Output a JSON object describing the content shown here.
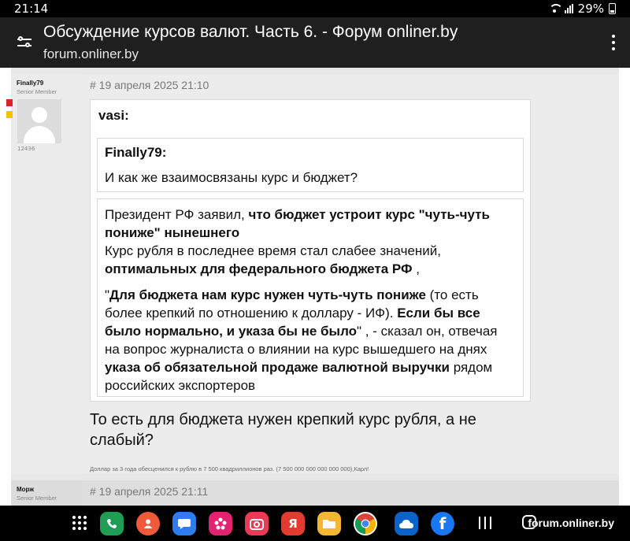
{
  "status": {
    "time": "21:14",
    "battery": "29%"
  },
  "browser": {
    "title": "Обсуждение курсов валют. Часть 6. - Форум onliner.by",
    "url": "forum.onliner.by"
  },
  "posts": [
    {
      "author": "Finally79",
      "rank": "Senior Member",
      "count": "12436",
      "date": "# 19 апреля 2025 21:10",
      "quote_author": "vasi:",
      "inner_quote_author": "Finally79:",
      "inner_quote_text": "И как же взаимосвязаны курс и бюджет?",
      "article": {
        "p1_a": "Президент РФ заявил, ",
        "p1_b": "что бюджет устроит курс \"чуть-чуть пониже\" нынешнего",
        "p1_c": "Курс рубля в последнее время стал слабее значений, ",
        "p1_d": "оптимальных для федерального бюджета РФ",
        "p1_e": " ,",
        "p2_a": "\"",
        "p2_b": "Для бюджета нам курс нужен чуть-чуть пониже",
        "p2_c": " (то есть более крепкий по отношению к доллару - ИФ). ",
        "p2_d": "Если бы все было нормально, и указа бы не было",
        "p2_e": "\" , - сказал он, отвечая на вопрос журналиста о влиянии на курс вышедшего на днях ",
        "p2_f": "указа об обязательной продаже валютной выручки",
        "p2_g": " рядом российских экспортеров"
      },
      "reply": "То есть для бюджета нужен крепкий курс рубля, а не слабый?",
      "signature": "Доллар за 3 года обесценился к рублю в 7 500 квадриллионов раз. (7 500 000 000 000 000 000),Карл!"
    },
    {
      "author": "Морж",
      "rank": "Senior Member",
      "date": "# 19 апреля 2025 21:11"
    }
  ],
  "navbar": {
    "icons": [
      "apps-grid-icon",
      "phone-icon",
      "contacts-icon",
      "messages-icon",
      "gallery-icon",
      "camera-icon",
      "yandex-icon",
      "files-icon",
      "chrome-icon",
      "onedrive-icon",
      "facebook-icon"
    ],
    "toast": "forum.onliner.by",
    "apps": {
      "facebook_glyph": "f",
      "yandex_glyph": "Я"
    }
  }
}
